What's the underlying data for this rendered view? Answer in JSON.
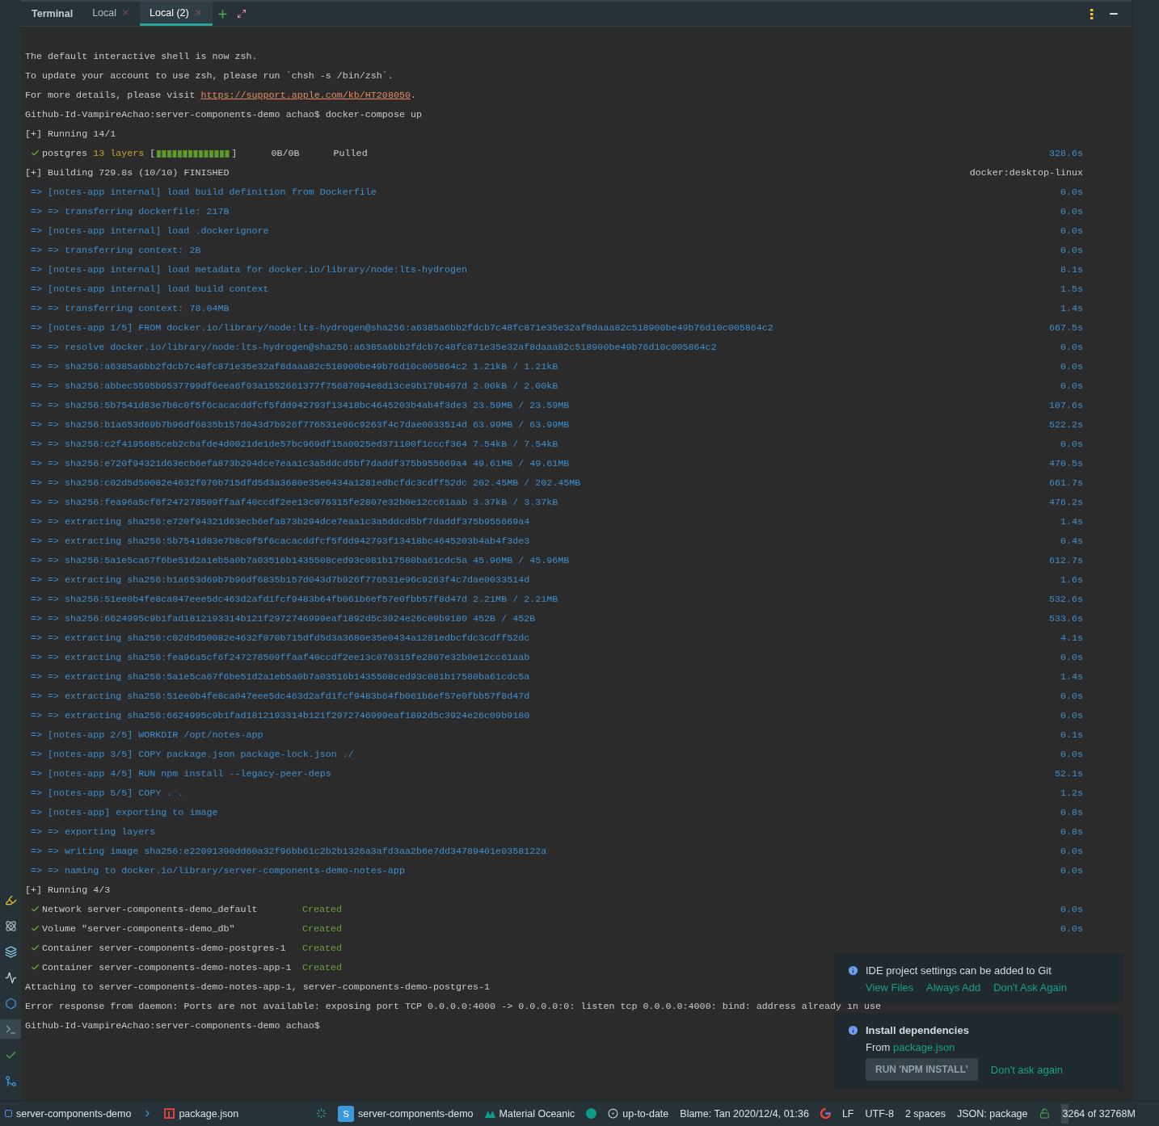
{
  "tool_window": {
    "title": "Terminal",
    "tabs": [
      {
        "label": "Local",
        "selected": false
      },
      {
        "label": "Local (2)",
        "selected": true
      }
    ]
  },
  "sidebar_tools": [
    {
      "kind": "marker",
      "selected": false
    },
    {
      "kind": "graph",
      "selected": false
    },
    {
      "kind": "layers",
      "selected": false
    },
    {
      "kind": "wave",
      "selected": false
    },
    {
      "kind": "hexagon",
      "selected": false
    },
    {
      "kind": "terminal",
      "selected": true
    },
    {
      "kind": "check",
      "selected": false
    },
    {
      "kind": "merge",
      "selected": false
    }
  ],
  "terminal_lines": [
    {
      "kind": "plain",
      "text": "The default interactive shell is now zsh."
    },
    {
      "kind": "plain",
      "text": "To update your account to use zsh, please run `chsh -s /bin/zsh`."
    },
    {
      "kind": "link",
      "text": "For more details, please visit ",
      "link": "https://support.apple.com/kb/HT208050",
      "after": "."
    },
    {
      "kind": "plain",
      "text": "Github-Id-VampireAchao:server-components-demo achao$ docker-compose up"
    },
    {
      "kind": "plain",
      "text": "[+] Running 14/1"
    },
    {
      "kind": "pull",
      "text": "postgres",
      "layers": "13 layers",
      "open": "[",
      "close": "]",
      "level": 1,
      "size": "0B/0B",
      "status": "Pulled",
      "time": "328.6s"
    },
    {
      "kind": "header",
      "text": "[+] Building 729.8s (10/10) FINISHED",
      "right": "docker:desktop-linux"
    },
    {
      "kind": "step",
      "text": "=> [notes-app internal] load build definition from Dockerfile",
      "time": "0.0s"
    },
    {
      "kind": "step",
      "text": "=> => transferring dockerfile: 217B",
      "time": "0.0s"
    },
    {
      "kind": "step",
      "text": "=> [notes-app internal] load .dockerignore",
      "time": "0.0s"
    },
    {
      "kind": "step",
      "text": "=> => transferring context: 2B",
      "time": "0.0s"
    },
    {
      "kind": "step",
      "text": "=> [notes-app internal] load metadata for docker.io/library/node:lts-hydrogen",
      "time": "8.1s"
    },
    {
      "kind": "step",
      "text": "=> [notes-app internal] load build context",
      "time": "1.5s"
    },
    {
      "kind": "step",
      "text": "=> => transferring context: 78.04MB",
      "time": "1.4s"
    },
    {
      "kind": "step",
      "text": "=> [notes-app 1/5] FROM docker.io/library/node:lts-hydrogen@sha256:a6385a6bb2fdcb7c48fc871e35e32af8daaa82c518900be49b76d10c005864c2",
      "time": "667.5s"
    },
    {
      "kind": "step",
      "text": "=> => resolve docker.io/library/node:lts-hydrogen@sha256:a6385a6bb2fdcb7c48fc871e35e32af8daaa82c518900be49b76d10c005864c2",
      "time": "0.0s"
    },
    {
      "kind": "step",
      "text": "=> => sha256:a6385a6bb2fdcb7c48fc871e35e32af8daaa82c518900be49b76d10c005864c2 1.21kB / 1.21kB",
      "time": "0.0s"
    },
    {
      "kind": "step",
      "text": "=> => sha256:abbec5595b9537799df6eea6f93a1552661377f75687094e8d13ce9b179b497d 2.00kB / 2.00kB",
      "time": "0.0s"
    },
    {
      "kind": "step",
      "text": "=> => sha256:5b7541d83e7b8c0f5f6cacacddfcf5fdd942793f13418bc4645203b4ab4f3de3 23.59MB / 23.59MB",
      "time": "107.6s"
    },
    {
      "kind": "step",
      "text": "=> => sha256:b1a653d69b7b96df6835b157d043d7b926f776531e96c9263f4c7dae0033514d 63.99MB / 63.99MB",
      "time": "522.2s"
    },
    {
      "kind": "step",
      "text": "=> => sha256:c2f4195685ceb2cbafde4d0021de1de57bc969df15a0025ed371100f1cccf364 7.54kB / 7.54kB",
      "time": "0.0s"
    },
    {
      "kind": "step",
      "text": "=> => sha256:e720f94321d63ecb6efa873b294dce7eaa1c3a5ddcd5bf7daddf375b955669a4 49.61MB / 49.61MB",
      "time": "470.5s"
    },
    {
      "kind": "step",
      "text": "=> => sha256:c02d5d50082e4632f070b715dfd5d3a3680e35e0434a1281edbcfdc3cdff52dc 202.45MB / 202.45MB",
      "time": "661.7s"
    },
    {
      "kind": "step",
      "text": "=> => sha256:fea96a5cf6f247278509ffaaf40ccdf2ee13c076315fe2807e32b0e12cc61aab 3.37kB / 3.37kB",
      "time": "476.2s"
    },
    {
      "kind": "step",
      "text": "=> => extracting sha256:e720f94321d63ecb6efa873b294dce7eaa1c3a5ddcd5bf7daddf375b955669a4",
      "time": "1.4s"
    },
    {
      "kind": "step",
      "text": "=> => extracting sha256:5b7541d83e7b8c0f5f6cacacddfcf5fdd942793f13418bc4645203b4ab4f3de3",
      "time": "0.4s"
    },
    {
      "kind": "step",
      "text": "=> => sha256:5a1e5ca67f6be51d2a1eb5a0b7a03516b1435508ced93c081b17580ba61cdc5a 45.96MB / 45.96MB",
      "time": "612.7s"
    },
    {
      "kind": "step",
      "text": "=> => extracting sha256:b1a653d69b7b96df6835b157d043d7b926f776531e96c9263f4c7dae0033514d",
      "time": "1.6s"
    },
    {
      "kind": "step",
      "text": "=> => sha256:51ee0b4fe8ca047eee5dc463d2afd1fcf9483b64fb061b6ef57e0fbb57f8d47d 2.21MB / 2.21MB",
      "time": "532.6s"
    },
    {
      "kind": "step",
      "text": "=> => sha256:6624995c9b1fad1812193314b121f2972746999eaf1892d5c3924e26c09b9180 452B / 452B",
      "time": "533.6s"
    },
    {
      "kind": "step",
      "text": "=> => extracting sha256:c02d5d50082e4632f070b715dfd5d3a3680e35e0434a1281edbcfdc3cdff52dc",
      "time": "4.1s"
    },
    {
      "kind": "step",
      "text": "=> => extracting sha256:fea96a5cf6f247278509ffaaf40ccdf2ee13c076315fe2807e32b0e12cc61aab",
      "time": "0.0s"
    },
    {
      "kind": "step",
      "text": "=> => extracting sha256:5a1e5ca67f6be51d2a1eb5a0b7a03516b1435508ced93c081b17580ba61cdc5a",
      "time": "1.4s"
    },
    {
      "kind": "step",
      "text": "=> => extracting sha256:51ee0b4fe8ca047eee5dc463d2afd1fcf9483b64fb061b6ef57e0fbb57f8d47d",
      "time": "0.0s"
    },
    {
      "kind": "step",
      "text": "=> => extracting sha256:6624995c9b1fad1812193314b121f2972746999eaf1892d5c3924e26c09b9180",
      "time": "0.0s"
    },
    {
      "kind": "step",
      "text": "=> [notes-app 2/5] WORKDIR /opt/notes-app",
      "time": "0.1s"
    },
    {
      "kind": "step",
      "text": "=> [notes-app 3/5] COPY package.json package-lock.json ./",
      "time": "0.0s"
    },
    {
      "kind": "step",
      "text": "=> [notes-app 4/5] RUN npm install --legacy-peer-deps",
      "time": "52.1s"
    },
    {
      "kind": "step",
      "text": "=> [notes-app 5/5] COPY . .",
      "time": "1.2s"
    },
    {
      "kind": "step",
      "text": "=> [notes-app] exporting to image",
      "time": "0.8s"
    },
    {
      "kind": "step",
      "text": "=> => exporting layers",
      "time": "0.8s"
    },
    {
      "kind": "step",
      "text": "=> => writing image sha256:e22091390dd60a32f96bb61c2b2b1326a3afd3aa2b6e7dd34789401e0358122a",
      "time": "0.0s"
    },
    {
      "kind": "step",
      "text": "=> => naming to docker.io/library/server-components-demo-notes-app",
      "time": "0.0s"
    },
    {
      "kind": "plain",
      "text": "[+] Running 4/3"
    },
    {
      "kind": "created",
      "text": "Network server-components-demo_default",
      "status": "Created",
      "time": "0.0s"
    },
    {
      "kind": "created",
      "text": "Volume \"server-components-demo_db\"",
      "status": "Created",
      "time": "0.0s"
    },
    {
      "kind": "created",
      "text": "Container server-components-demo-postgres-1",
      "status": "Created"
    },
    {
      "kind": "created",
      "text": "Container server-components-demo-notes-app-1",
      "status": "Created"
    },
    {
      "kind": "plain",
      "text": "Attaching to server-components-demo-notes-app-1, server-components-demo-postgres-1"
    },
    {
      "kind": "plain",
      "text": "Error response from daemon: Ports are not available: exposing port TCP 0.0.0.0:4000 -> 0.0.0.0:0: listen tcp 0.0.0.0:4000: bind: address already in use"
    },
    {
      "kind": "plain",
      "text": "Github-Id-VampireAchao:server-components-demo achao$"
    }
  ],
  "notifications": [
    {
      "kind": "git",
      "title": "IDE project settings can be added to Git",
      "actions": [
        "View Files",
        "Always Add",
        "Don't Ask Again"
      ]
    },
    {
      "kind": "npm",
      "title": "Install dependencies",
      "body": "From",
      "body_link": "package.json",
      "button": "RUN 'NPM INSTALL'",
      "actions": [
        "Don't ask again"
      ]
    }
  ],
  "status_bar": {
    "project": "server-components-demo",
    "file": "package.json",
    "interpreter_badge": "S",
    "interpreter": "server-components-demo",
    "theme": "Material Oceanic",
    "vcs": "up-to-date",
    "blame": "Blame: Tan 2020/12/4, 01:36",
    "line_separator": "LF",
    "encoding": "UTF-8",
    "indent": "2 spaces",
    "schema": "JSON: package",
    "memory": {
      "text": "3264 of 32768M",
      "level": 0.1
    }
  }
}
